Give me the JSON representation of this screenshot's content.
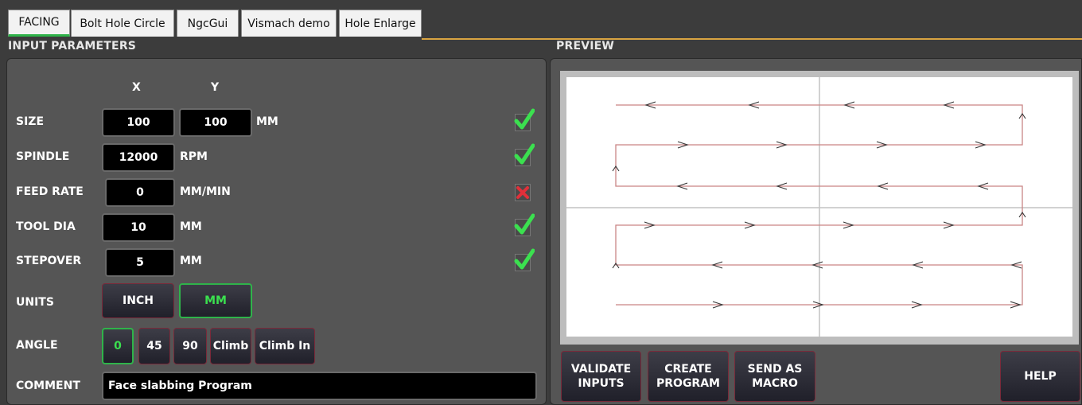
{
  "tabs": [
    {
      "label": "FACING",
      "active": true
    },
    {
      "label": "Bolt Hole Circle",
      "active": false
    },
    {
      "label": "NgcGui",
      "active": false
    },
    {
      "label": "Vismach demo",
      "active": false
    },
    {
      "label": "Hole Enlarge",
      "active": false
    }
  ],
  "input_panel": {
    "title": "INPUT PARAMETERS",
    "col_x": "X",
    "col_y": "Y",
    "size": {
      "label": "SIZE",
      "x": "100",
      "y": "100",
      "unit": "MM",
      "valid": true
    },
    "spindle": {
      "label": "SPINDLE",
      "value": "12000",
      "unit": "RPM",
      "valid": true
    },
    "feed_rate": {
      "label": "FEED RATE",
      "value": "0",
      "unit": "MM/MIN",
      "valid": false
    },
    "tool_dia": {
      "label": "TOOL DIA",
      "value": "10",
      "unit": "MM",
      "valid": true
    },
    "stepover": {
      "label": "STEPOVER",
      "value": "5",
      "unit": "MM",
      "valid": true
    },
    "units": {
      "label": "UNITS",
      "options": [
        "INCH",
        "MM"
      ],
      "selected": "MM"
    },
    "angle": {
      "label": "ANGLE",
      "options": [
        "0",
        "45",
        "90",
        "Climb",
        "Climb In"
      ],
      "selected": "0"
    },
    "comment": {
      "label": "COMMENT",
      "value": "Face slabbing Program"
    }
  },
  "preview": {
    "title": "PREVIEW",
    "buttons": {
      "validate": "VALIDATE\nINPUTS",
      "create": "CREATE\nPROGRAM",
      "send": "SEND AS\nMACRO",
      "help": "HELP"
    }
  },
  "colors": {
    "accent_green": "#2fb34a",
    "error_red": "#e0303a",
    "tab_line": "#d9a441",
    "toolpath": "#c98585"
  }
}
